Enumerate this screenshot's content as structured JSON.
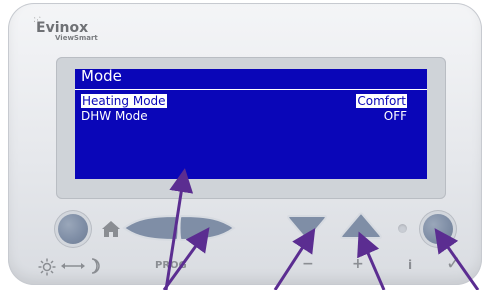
{
  "brand": {
    "name": "Evinox",
    "sub": "ViewSmart"
  },
  "screen": {
    "title": "Mode",
    "rows": [
      {
        "label": "Heating Mode",
        "value": "Comfort",
        "selected": true
      },
      {
        "label": "DHW Mode",
        "value": "OFF",
        "selected": false
      }
    ]
  },
  "buttons": {
    "prog_label": "PROG",
    "minus_label": "−",
    "plus_label": "+",
    "info_label": "i",
    "ok_label": "✓"
  },
  "colors": {
    "lcd": "#0a06b8",
    "button": "#7f8ea6",
    "arrow": "#5b2d91"
  }
}
